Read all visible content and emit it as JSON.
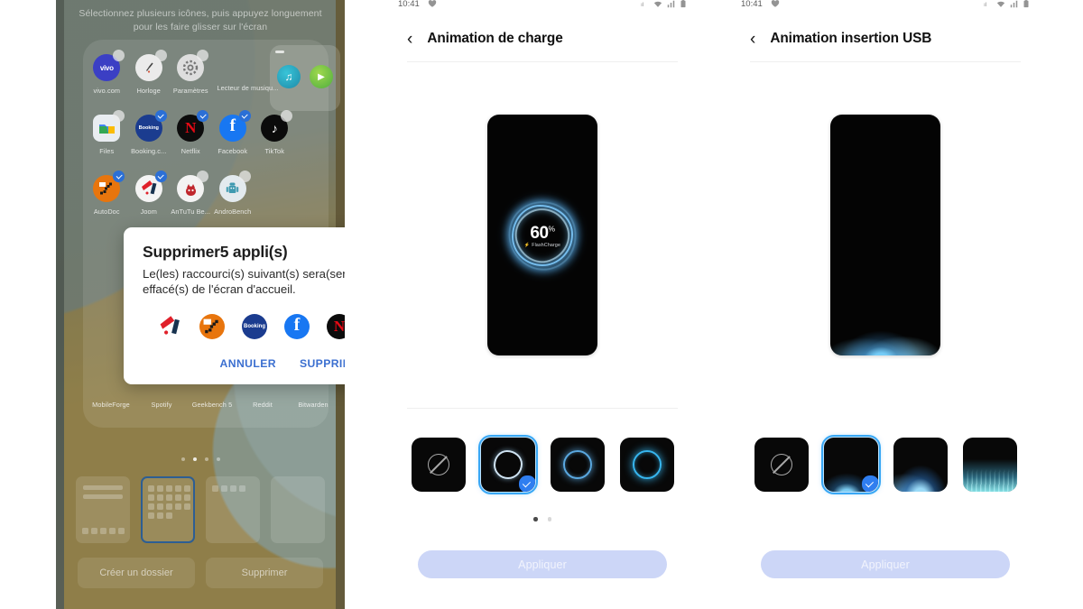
{
  "home": {
    "hint": "Sélectionnez plusieurs icônes, puis appuyez longuement pour les faire glisser sur l'écran",
    "apps": [
      [
        {
          "label": "vivo.com",
          "icon": "vivo-app-icon",
          "selected": false,
          "color": "#3b3fc4",
          "glyph": "vivo"
        },
        {
          "label": "Horloge",
          "icon": "clock-app-icon",
          "selected": false,
          "color": "#e9e9e9",
          "glyph": ""
        },
        {
          "label": "Paramètres",
          "icon": "settings-app-icon",
          "selected": false,
          "color": "#dcdcdc",
          "glyph": ""
        },
        {
          "label": "Lecteur de musiqu...",
          "icon": "music-player-widget",
          "selected": false,
          "color": "",
          "glyph": ""
        }
      ],
      [
        {
          "label": "Files",
          "icon": "files-app-icon",
          "selected": false,
          "color": "#e7eaee",
          "glyph": ""
        },
        {
          "label": "Booking.c...",
          "icon": "booking-app-icon",
          "selected": true,
          "color": "#1b3c8f",
          "glyph": "Booking"
        },
        {
          "label": "Netflix",
          "icon": "netflix-app-icon",
          "selected": true,
          "color": "#0c0c0c",
          "glyph": "N"
        },
        {
          "label": "Facebook",
          "icon": "facebook-app-icon",
          "selected": true,
          "color": "#1877f2",
          "glyph": "f"
        },
        {
          "label": "TikTok",
          "icon": "tiktok-app-icon",
          "selected": false,
          "color": "#0b0b0b",
          "glyph": "♪"
        }
      ],
      [
        {
          "label": "AutoDoc",
          "icon": "autodoc-app-icon",
          "selected": true,
          "color": "#e8750d",
          "glyph": ""
        },
        {
          "label": "Joom",
          "icon": "joom-app-icon",
          "selected": true,
          "color": "#f2f2f2",
          "glyph": ""
        },
        {
          "label": "AnTuTu Be...",
          "icon": "antutu-app-icon",
          "selected": false,
          "color": "#f0f0f0",
          "glyph": ""
        },
        {
          "label": "AndroBench",
          "icon": "androbench-app-icon",
          "selected": false,
          "color": "#dfe6ea",
          "glyph": ""
        }
      ]
    ],
    "dock": [
      {
        "label": "MobileForge",
        "icon": "mobileforge-app-icon"
      },
      {
        "label": "Spotify",
        "icon": "spotify-app-icon"
      },
      {
        "label": "Geekbench 5",
        "icon": "geekbench-app-icon"
      },
      {
        "label": "Reddit",
        "icon": "reddit-app-icon"
      },
      {
        "label": "Bitwarden",
        "icon": "bitwarden-app-icon"
      }
    ],
    "page_dots": 4,
    "active_page": 1,
    "widget_tiles": 4,
    "selected_widget_tile": 1,
    "actions": {
      "create_folder": "Créer un dossier",
      "delete": "Supprimer"
    }
  },
  "dialog": {
    "title": "Supprimer5 appli(s)",
    "body": "Le(les) raccourci(s) suivant(s) sera(seront) effacé(s) de l'écran d'accueil.",
    "icons": [
      {
        "name": "joom-app-icon",
        "color": "#f7f7f7",
        "glyph": ""
      },
      {
        "name": "autodoc-app-icon",
        "color": "#e8750d",
        "glyph": ""
      },
      {
        "name": "booking-app-icon",
        "color": "#1b3c8f",
        "glyph": "Booking"
      },
      {
        "name": "facebook-app-icon",
        "color": "#1877f2",
        "glyph": "f"
      },
      {
        "name": "netflix-app-icon",
        "color": "#0c0c0c",
        "glyph": "N"
      }
    ],
    "cancel_label": "ANNULER",
    "confirm_label": "SUPPRIMER"
  },
  "statusbar": {
    "time": "10:41",
    "left_icons": [
      "heart-icon"
    ],
    "right_icons": [
      "network-icon",
      "wifi-icon",
      "signal-icon",
      "battery-icon"
    ]
  },
  "charge_screen": {
    "title": "Animation de charge",
    "back_icon": "chevron-left-icon",
    "preview": {
      "percent": "60",
      "percent_unit": "%",
      "charge_label": "FlashCharge",
      "charge_bolt": "⚡"
    },
    "thumbnails": [
      {
        "name": "animation-none",
        "style": "none",
        "selected": false
      },
      {
        "name": "animation-ring-soft",
        "style": "ring-soft",
        "selected": true
      },
      {
        "name": "animation-ring-blue",
        "style": "ring-blue",
        "selected": false
      },
      {
        "name": "animation-ring-cyan",
        "style": "ring-cyan",
        "selected": false
      }
    ],
    "page_dots": 2,
    "active_dot": 0,
    "apply_label": "Appliquer"
  },
  "usb_screen": {
    "title": "Animation insertion USB",
    "back_icon": "chevron-left-icon",
    "thumbnails": [
      {
        "name": "animation-none",
        "style": "none",
        "selected": false
      },
      {
        "name": "animation-sparkle",
        "style": "wave-a",
        "selected": true
      },
      {
        "name": "animation-wave",
        "style": "wave-b",
        "selected": false
      },
      {
        "name": "animation-flame",
        "style": "wave-c",
        "selected": false
      }
    ],
    "apply_label": "Appliquer"
  },
  "colors": {
    "accent_blue": "#3b6fd0",
    "selection_blue": "#2f7ef0",
    "apply_button": "#ccd6f7",
    "thumb_border": "#38a7f5"
  }
}
